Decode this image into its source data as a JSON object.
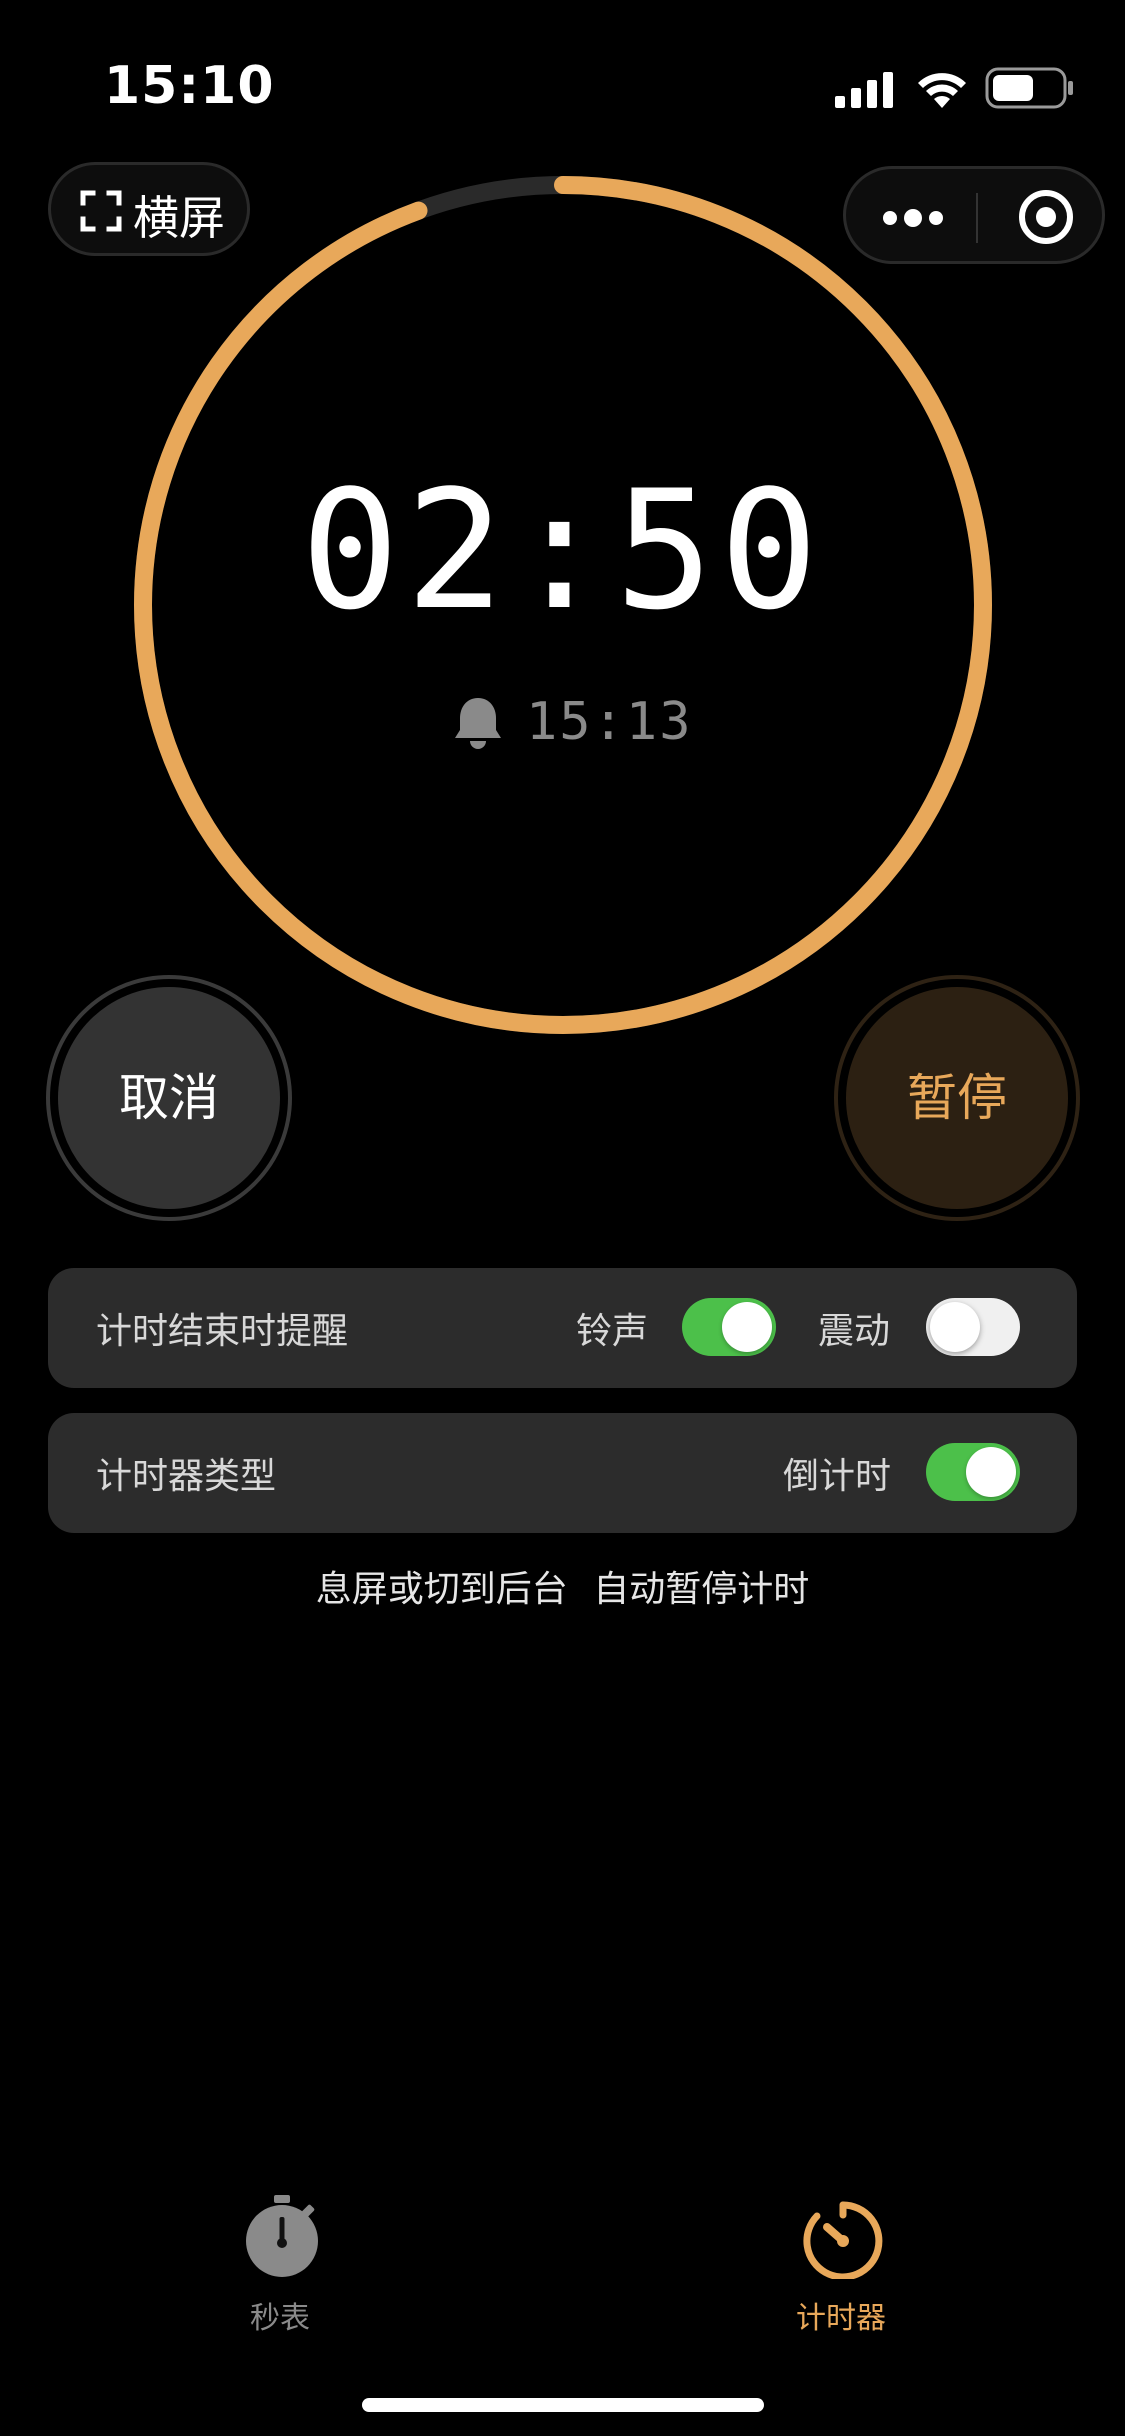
{
  "status_bar": {
    "time": "15:10",
    "icons": [
      "cellular-signal-icon",
      "wifi-icon",
      "battery-icon"
    ]
  },
  "top_bar": {
    "landscape_label": "横屏",
    "landscape_icon": "fullscreen-icon",
    "capsule_icons": [
      "more-icon",
      "close-target-icon"
    ]
  },
  "timer": {
    "remaining": "02:50",
    "alarm_time": "15:13",
    "alarm_icon": "bell-icon",
    "progress_fraction_remaining": 0.944,
    "accent_color": "#E8A85A",
    "track_color": "#2A2A2A"
  },
  "buttons": {
    "cancel_label": "取消",
    "pause_label": "暂停"
  },
  "settings": {
    "reminder": {
      "title": "计时结束时提醒",
      "ring_label": "铃声",
      "ring_on": true,
      "vibrate_label": "震动",
      "vibrate_on": false
    },
    "timer_type": {
      "title": "计时器类型",
      "mode_label": "倒计时",
      "mode_on": true
    }
  },
  "hint": "息屏或切到后台  自动暂停计时",
  "tabs": [
    {
      "label": "秒表",
      "icon": "stopwatch-icon",
      "active": false,
      "color": "#8A8A8A"
    },
    {
      "label": "计时器",
      "icon": "timer-icon",
      "active": true,
      "color": "#E8A85A"
    }
  ]
}
